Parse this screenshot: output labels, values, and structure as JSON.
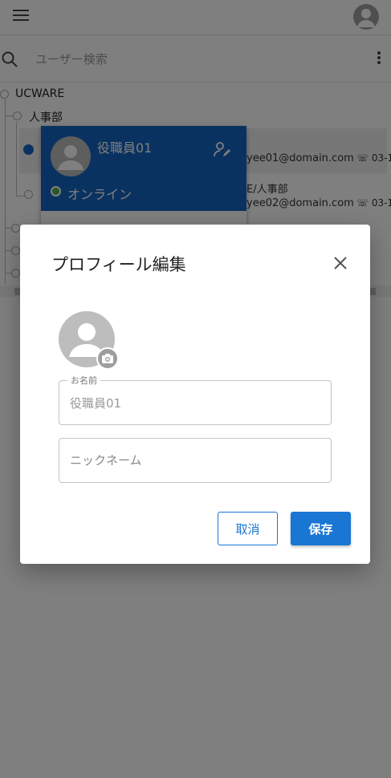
{
  "header": {
    "menu_icon": "hamburger-menu-icon",
    "avatar_icon": "user-avatar-icon"
  },
  "search": {
    "placeholder": "ユーザー検索"
  },
  "tree": {
    "root": "UCWARE",
    "dept": "人事部",
    "rows": [
      {
        "email": "yee01@domain.com",
        "phone": "03-1"
      },
      {
        "dept_path": "E/人事部",
        "email": "yee02@domain.com",
        "phone": "03-1"
      }
    ]
  },
  "profile_card": {
    "name": "役職員01",
    "status": "オンライン",
    "status_color": "#4caf50"
  },
  "dialog": {
    "title": "プロフィール編集",
    "name_field": {
      "label": "お名前",
      "value": "役職員01"
    },
    "nickname_field": {
      "placeholder": "ニックネーム"
    },
    "cancel_label": "取消",
    "save_label": "保存"
  },
  "colors": {
    "primary": "#1976d2",
    "card_blue": "#1565c0",
    "overlay": "rgba(0,0,0,0.5)"
  }
}
